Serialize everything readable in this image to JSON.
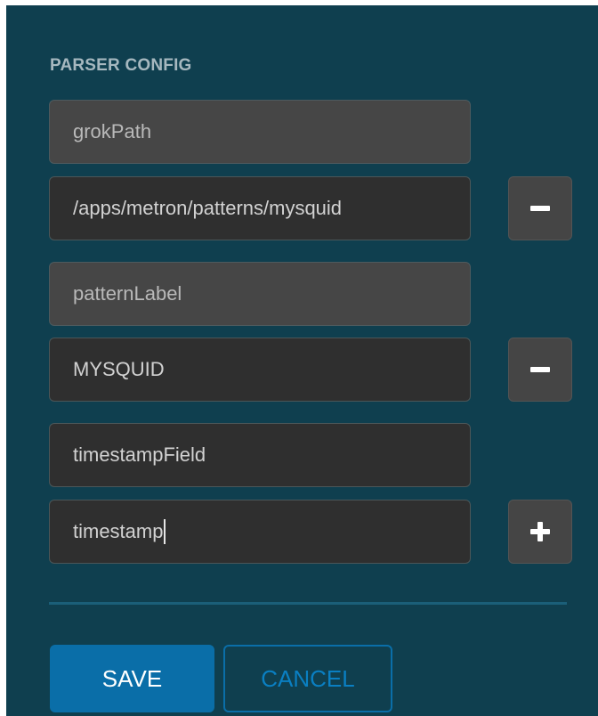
{
  "section": {
    "title": "PARSER CONFIG"
  },
  "config_rows": [
    {
      "key": "grokPath",
      "value": "/apps/metron/patterns/mysquid",
      "action": "remove"
    },
    {
      "key": "patternLabel",
      "value": "MYSQUID",
      "action": "remove"
    },
    {
      "key": "timestampField",
      "value": "timestamp",
      "action": "add"
    }
  ],
  "icons": {
    "remove": "minus-icon",
    "add": "plus-icon"
  },
  "actions": {
    "save_label": "SAVE",
    "cancel_label": "CANCEL"
  },
  "colors": {
    "panel_bg": "#0f3f4f",
    "primary": "#0a6ea8",
    "field_bg": "#2f2f2f",
    "readonly_field_bg": "#464646"
  }
}
